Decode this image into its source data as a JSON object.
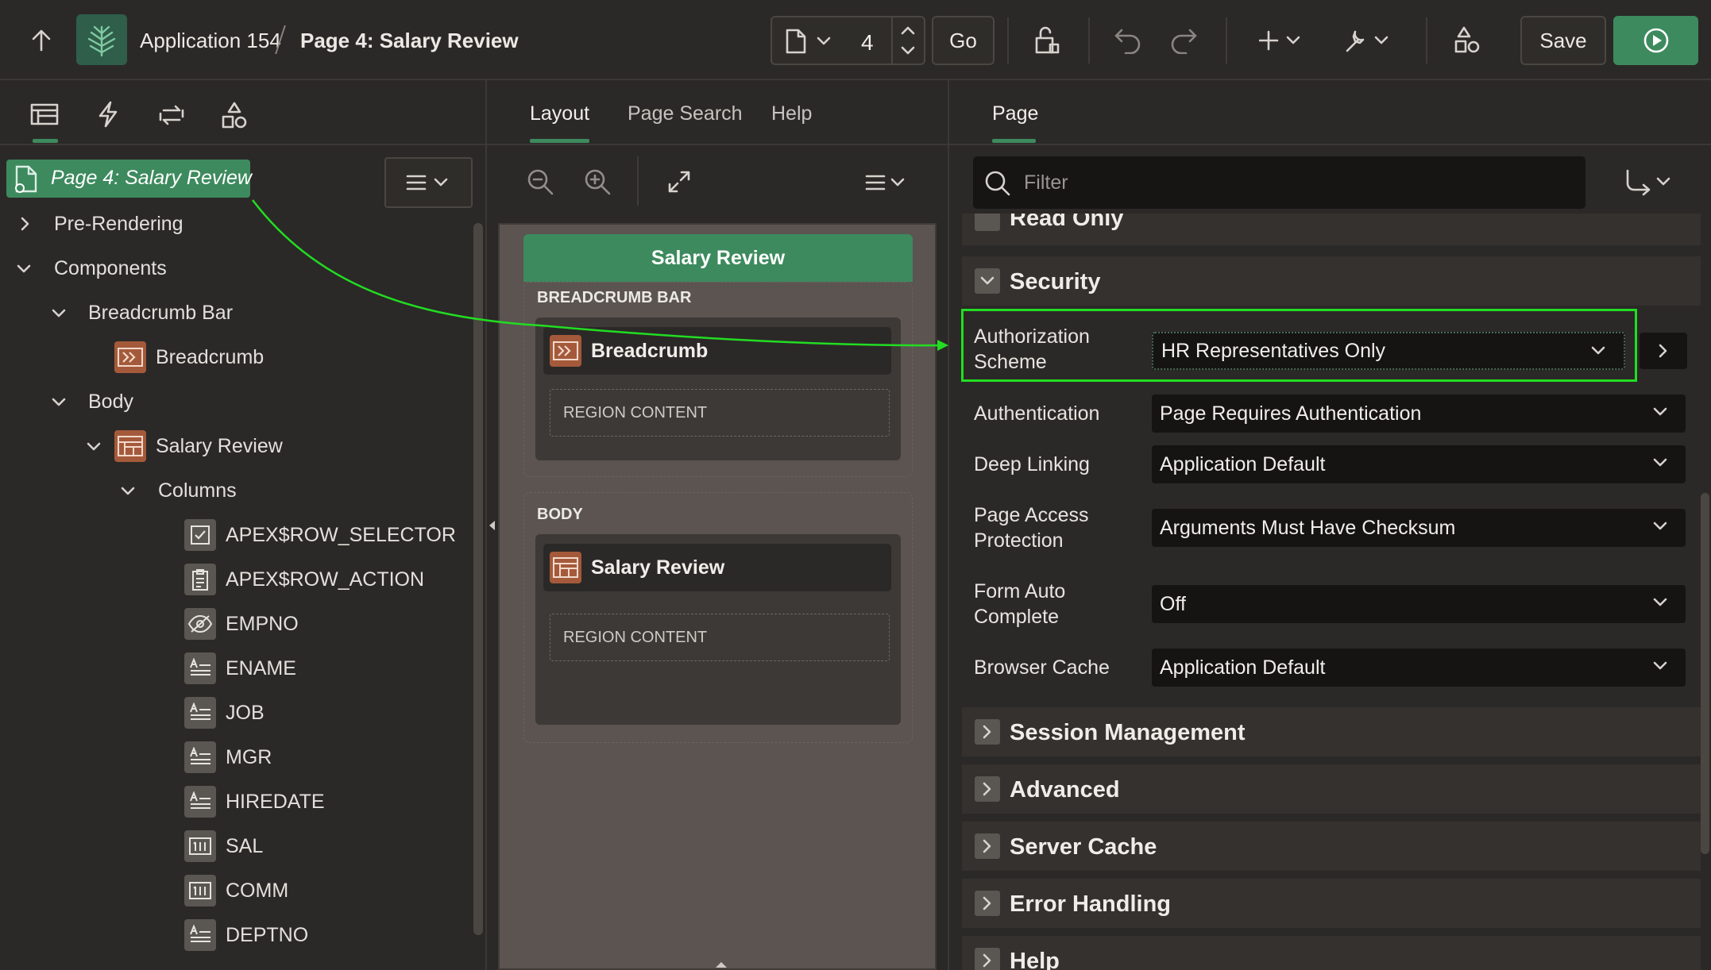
{
  "topbar": {
    "app_name": "Application 154",
    "page_title": "Page 4: Salary Review",
    "page_number": "4",
    "go_label": "Go",
    "save_label": "Save"
  },
  "left": {
    "page_node": "Page 4: Salary Review",
    "items": {
      "pre_rendering": "Pre-Rendering",
      "components": "Components",
      "breadcrumb_bar": "Breadcrumb Bar",
      "breadcrumb": "Breadcrumb",
      "body": "Body",
      "salary_review": "Salary Review",
      "columns": "Columns"
    },
    "columns": [
      "APEX$ROW_SELECTOR",
      "APEX$ROW_ACTION",
      "EMPNO",
      "ENAME",
      "JOB",
      "MGR",
      "HIREDATE",
      "SAL",
      "COMM",
      "DEPTNO"
    ]
  },
  "middle": {
    "tabs": [
      "Layout",
      "Page Search",
      "Help"
    ],
    "page_header": "Salary Review",
    "breadcrumb_bar_label": "BREADCRUMB BAR",
    "breadcrumb_region": "Breadcrumb",
    "region_content": "REGION CONTENT",
    "body_label": "BODY",
    "salary_region": "Salary Review"
  },
  "right": {
    "tab": "Page",
    "filter_placeholder": "Filter",
    "read_only": "Read Only",
    "security_title": "Security",
    "props": {
      "auth_scheme_label_1": "Authorization",
      "auth_scheme_label_2": "Scheme",
      "auth_scheme_value": "HR Representatives Only",
      "authentication_label": "Authentication",
      "authentication_value": "Page Requires Authentication",
      "deep_linking_label": "Deep Linking",
      "deep_linking_value": "Application Default",
      "page_access_label_1": "Page Access",
      "page_access_label_2": "Protection",
      "page_access_value": "Arguments Must Have Checksum",
      "form_auto_label_1": "Form Auto",
      "form_auto_label_2": "Complete",
      "form_auto_value": "Off",
      "browser_cache_label": "Browser Cache",
      "browser_cache_value": "Application Default"
    },
    "sections": [
      "Session Management",
      "Advanced",
      "Server Cache",
      "Error Handling",
      "Help"
    ]
  },
  "colors": {
    "accent_green": "#3d8a5e",
    "highlight_green": "#22dd22",
    "region_orange": "#a45a3a"
  }
}
